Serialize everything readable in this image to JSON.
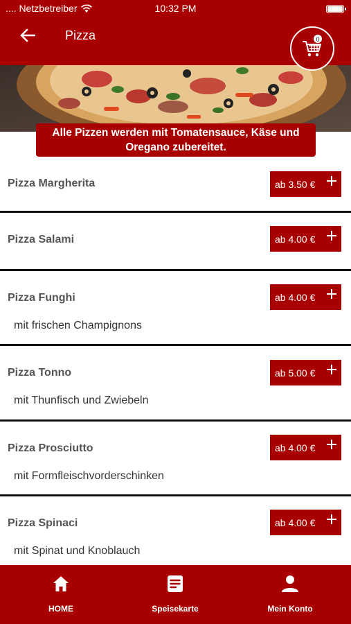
{
  "status_bar": {
    "carrier": ".... Netzbetreiber",
    "time": "10:32 PM"
  },
  "nav": {
    "title": "Pizza",
    "cart_count": "0"
  },
  "banner": {
    "text": "Alle Pizzen werden mit Tomatensauce, Käse und Oregano zubereitet."
  },
  "items": [
    {
      "name": "Pizza Margherita",
      "desc": "",
      "price": "ab 3.50 €"
    },
    {
      "name": "Pizza Salami",
      "desc": "",
      "price": "ab 4.00 €"
    },
    {
      "name": "Pizza Funghi",
      "desc": "mit frischen Champignons",
      "price": "ab 4.00 €"
    },
    {
      "name": "Pizza Tonno",
      "desc": "mit Thunfisch und Zwiebeln",
      "price": "ab 5.00 €"
    },
    {
      "name": "Pizza Prosciutto",
      "desc": "mit Formfleischvorderschinken",
      "price": "ab 4.00 €"
    },
    {
      "name": "Pizza Spinaci",
      "desc": "mit Spinat und Knoblauch",
      "price": "ab 4.00 €"
    }
  ],
  "tabs": [
    {
      "label": "HOME",
      "icon": "home-icon"
    },
    {
      "label": "Speisekarte",
      "icon": "menu-card-icon"
    },
    {
      "label": "Mein Konto",
      "icon": "user-icon"
    }
  ],
  "colors": {
    "brand": "#a80000"
  }
}
